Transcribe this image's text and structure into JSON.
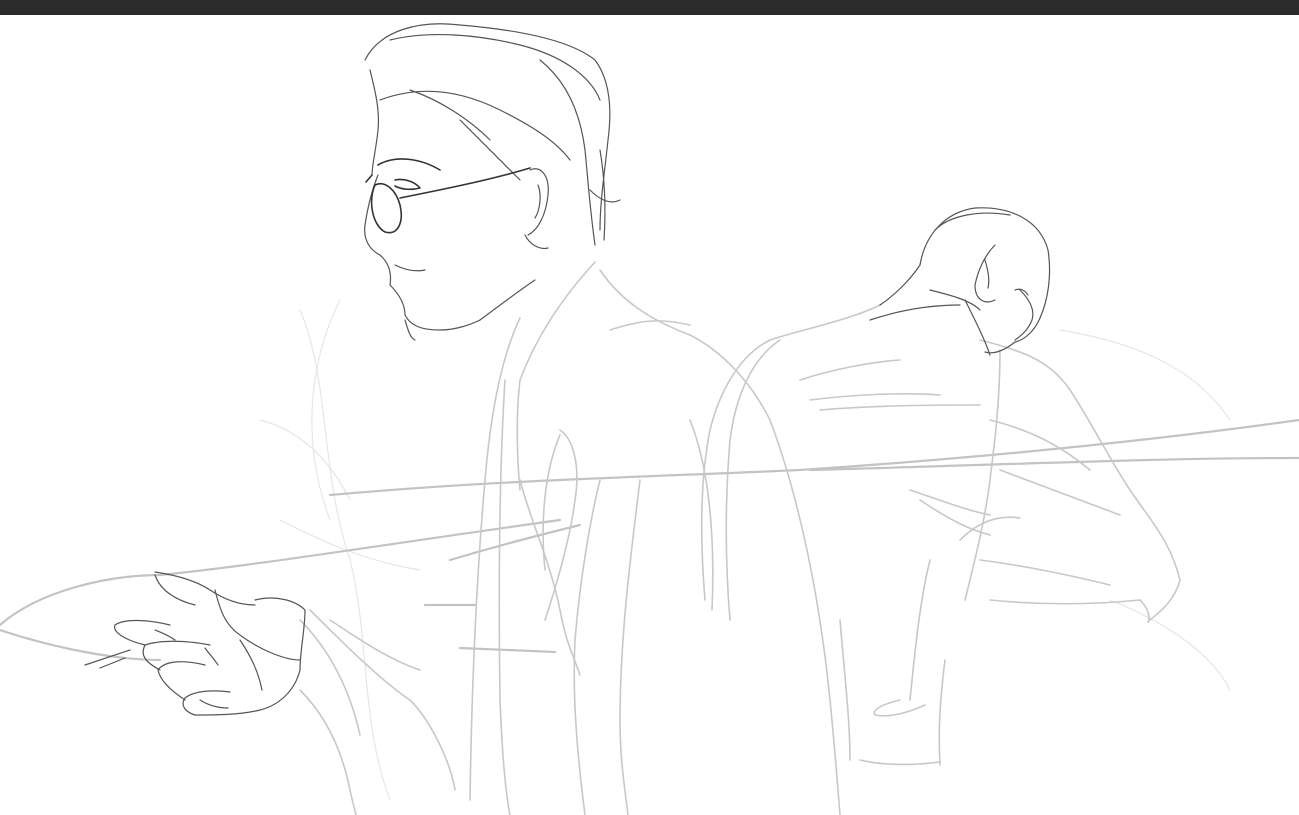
{
  "app": {
    "title": "",
    "topbar_color": "#2b2b2b",
    "canvas_color": "#ffffff"
  },
  "canvas": {
    "content": "sketch",
    "stroke_colors": {
      "ink": "#333333",
      "pencil": "#555555",
      "light": "#c3c3c3",
      "faint": "#e6e6e6"
    }
  }
}
